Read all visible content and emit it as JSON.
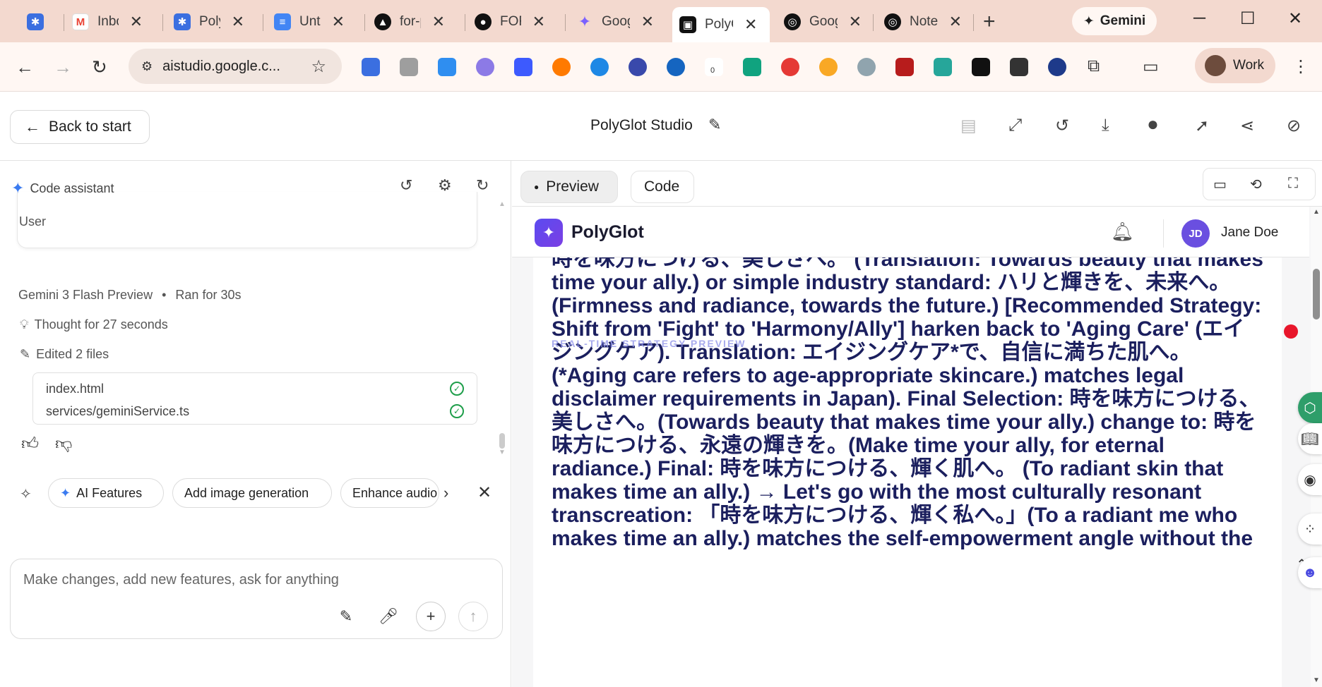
{
  "browser": {
    "tabs": [
      {
        "title": "",
        "favicon": "gear-icon",
        "color": "#3b6fe0"
      },
      {
        "title": "Inbox",
        "favicon": "gmail-icon",
        "color": "#ea4335"
      },
      {
        "title": "PolyGlot",
        "favicon": "gear-icon",
        "color": "#3b6fe0"
      },
      {
        "title": "Untitled",
        "favicon": "docs-icon",
        "color": "#4285f4"
      },
      {
        "title": "for-p",
        "favicon": "triangle-icon",
        "color": "#111111"
      },
      {
        "title": "FOR",
        "favicon": "github-icon",
        "color": "#111111"
      },
      {
        "title": "Goog",
        "favicon": "gemini-icon",
        "color": "#7b61ff"
      },
      {
        "title": "PolyC",
        "favicon": "aistudio-icon",
        "color": "#111111"
      },
      {
        "title": "Goog",
        "favicon": "notebook-icon",
        "color": "#111111"
      },
      {
        "title": "Note",
        "favicon": "notebook-icon",
        "color": "#111111"
      }
    ],
    "gemini_button": "Gemini",
    "url": "aistudio.google.c...",
    "profile": "Work",
    "extension_badge": "0"
  },
  "app": {
    "back_label": "Back to start",
    "project_title": "PolyGlot Studio"
  },
  "left": {
    "assistant_title": "Code assistant",
    "user_label": "User",
    "model": "Gemini 3 Flash Preview",
    "ran_for": "Ran for 30s",
    "thought": "Thought for 27 seconds",
    "edited": "Edited 2 files",
    "files": [
      "index.html",
      "services/geminiService.ts"
    ],
    "chips": [
      "AI Features",
      "Add image generation",
      "Enhance audio"
    ],
    "composer_placeholder": "Make changes, add new features, ask for anything"
  },
  "right": {
    "tab_preview": "Preview",
    "tab_code": "Code",
    "preview_app": {
      "name": "PolyGlot",
      "avatar_initials": "JD",
      "user_name": "Jane Doe",
      "overlay_label": "REAL-TIME STRATEGY PREVIEW",
      "strategy_text": "時を味方につける、美しさへ。 (Translation: Towards beauty that makes time your ally.) or simple industry standard: ハリと輝きを、未来へ。 (Firmness and radiance, towards the future.) [Recommended Strategy: Shift from 'Fight' to 'Harmony/Ally'] harken back to 'Aging Care' (エイジングケア). Translation: エイジングケア*で、自信に満ちた肌へ。 (*Aging care refers to age-appropriate skincare.) matches legal disclaimer requirements in Japan). Final Selection: 時を味方につける、美しさへ。(Towards beauty that makes time your ally.) change to: 時を味方につける、永遠の輝きを。(Make time your ally, for eternal radiance.) Final: 時を味方につける、輝く肌へ。 (To radiant skin that makes time an ally.) → Let's go with the most culturally resonant transcreation: 「時を味方につける、輝く私へ。」(To a radiant me who makes time an ally.) matches the self-empowerment angle without the"
    }
  },
  "colors": {
    "tabstrip": "#f3d9cf",
    "toolbar": "#fff7f3",
    "accent": "#3b7bf0",
    "strategy_text": "#1b1f5e",
    "brand": "#5b4bf0"
  }
}
